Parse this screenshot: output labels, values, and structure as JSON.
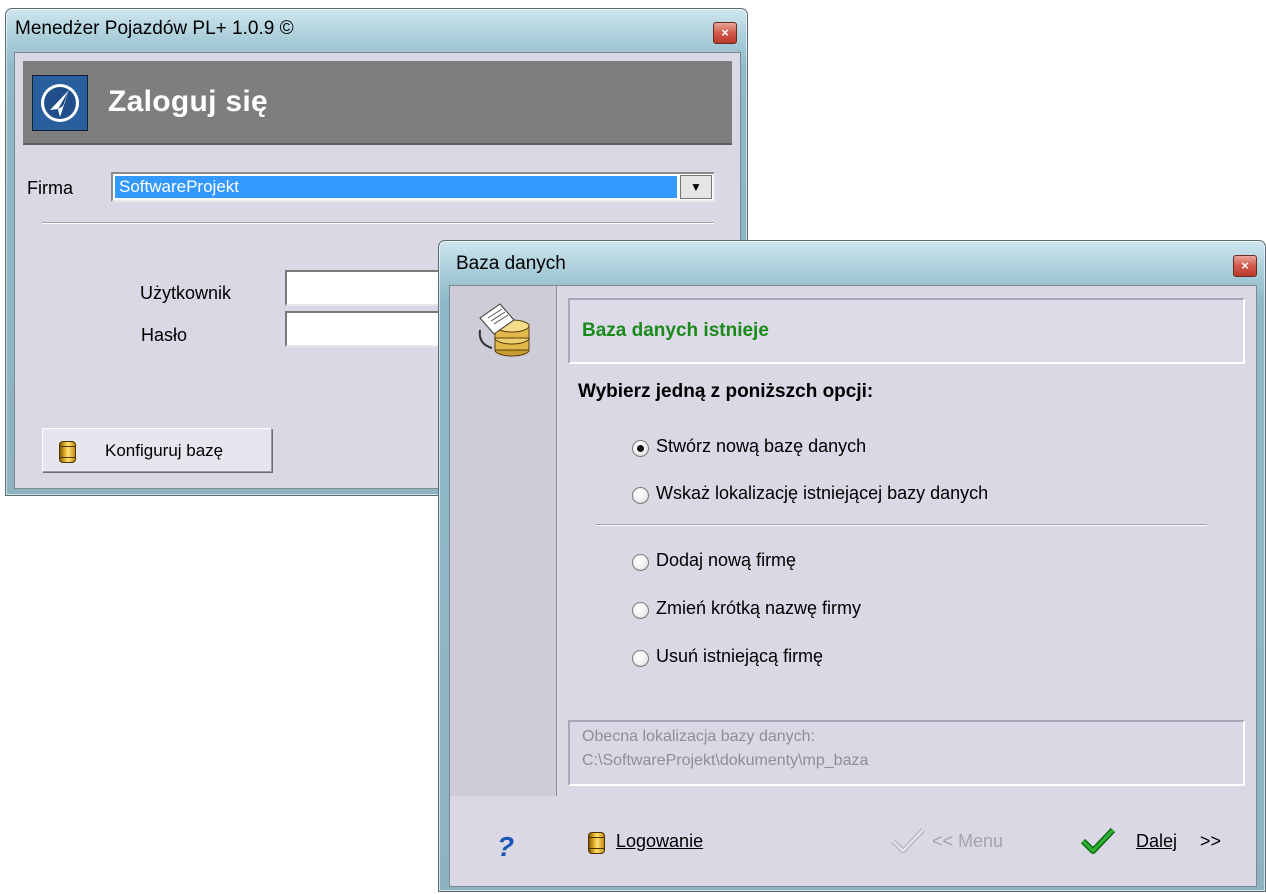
{
  "login_window": {
    "title": "Menedżer Pojazdów PL+ 1.0.9  ©",
    "close_glyph": "×",
    "banner_title": "Zaloguj się",
    "logo_icon": "app-logo-icon",
    "firma_label": "Firma",
    "firma_selected": "SoftwareProjekt",
    "dropdown_arrow": "▼",
    "user_label": "Użytkownik",
    "user_value": "",
    "password_label": "Hasło",
    "password_value": "",
    "configure_button": "Konfiguruj bazę"
  },
  "db_window": {
    "title": "Baza danych",
    "close_glyph": "×",
    "header": "Baza danych istnieje",
    "prompt": "Wybierz jedną z poniższch opcji:",
    "options": [
      {
        "label": "Stwórz nową bazę danych",
        "checked": true
      },
      {
        "label": "Wskaż lokalizację istniejącej bazy danych",
        "checked": false
      },
      {
        "label": "Dodaj nową firmę",
        "checked": false
      },
      {
        "label": "Zmień krótką nazwę firmy",
        "checked": false
      },
      {
        "label": "Usuń istniejącą firmę",
        "checked": false
      }
    ],
    "location_label": "Obecna lokalizacja bazy danych:",
    "location_path": "C:\\SoftwareProjekt\\dokumenty\\mp_baza",
    "help_glyph": "?",
    "login_button": "Logowanie",
    "menu_button": "<< Menu",
    "next_button": "Dalej",
    "next_suffix": ">>",
    "colors": {
      "header_green": "#1a8a1a",
      "link_blue": "#1b55b8",
      "selection_blue": "#3399ff"
    }
  }
}
